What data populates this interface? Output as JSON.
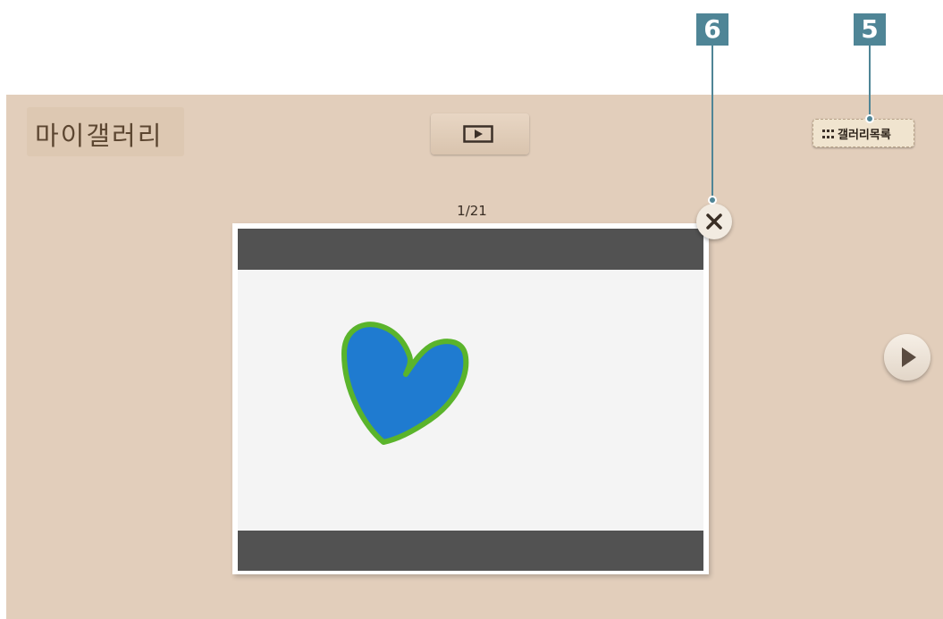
{
  "app": {
    "title": "마이갤러리"
  },
  "toolbar": {
    "slideshow_icon": "play-in-rectangle",
    "gallery_list_label": "갤러리목록",
    "gallery_list_icon": "grid-icon"
  },
  "viewer": {
    "counter": "1/21",
    "close_icon": "close-x",
    "next_icon": "play-triangle"
  },
  "callouts": [
    {
      "label": "6"
    },
    {
      "label": "5"
    }
  ],
  "colors": {
    "panel_background": "#e2cebb",
    "callout": "#4f8596",
    "heart_fill": "#1f7bd0",
    "heart_outline": "#5ab42b",
    "photo_letterbox": "#525252"
  }
}
